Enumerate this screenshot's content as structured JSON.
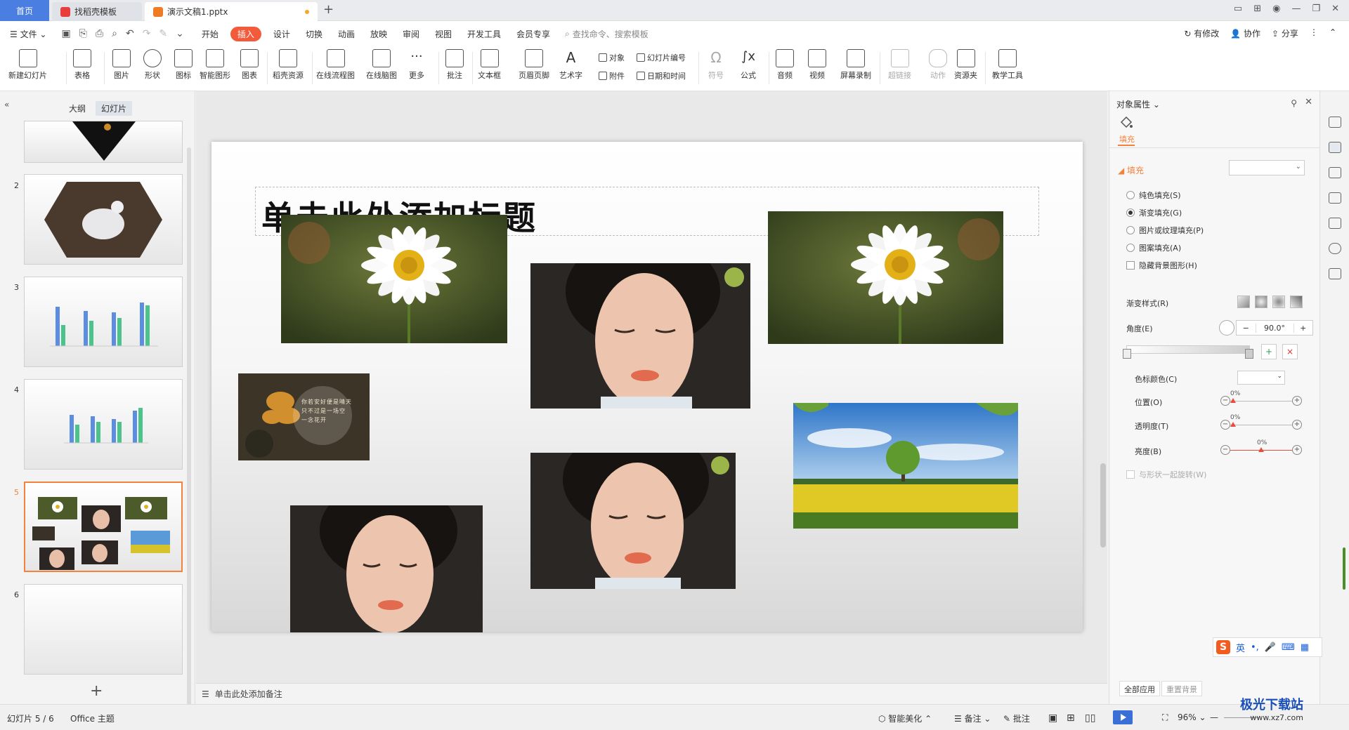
{
  "tabs": {
    "home": "首页",
    "find_template": "找稻壳模板",
    "document": "演示文稿1.pptx"
  },
  "menu": {
    "file": "文件",
    "items": [
      "开始",
      "插入",
      "设计",
      "切换",
      "动画",
      "放映",
      "审阅",
      "视图",
      "开发工具",
      "会员专享"
    ],
    "active": "插入",
    "search": "查找命令、搜索模板",
    "right": [
      "有修改",
      "协作",
      "分享"
    ]
  },
  "ribbon": {
    "new_slide": "新建幻灯片",
    "table": "表格",
    "picture": "图片",
    "shape": "形状",
    "icon": "图标",
    "smart_art": "智能图形",
    "chart": "图表",
    "docer": "稻壳资源",
    "flowchart": "在线流程图",
    "mindmap": "在线脑图",
    "more": "更多",
    "comment": "批注",
    "textbox": "文本框",
    "header_footer": "页眉页脚",
    "wordart": "艺术字",
    "object": "对象",
    "attachment": "附件",
    "slide_number": "幻灯片编号",
    "datetime": "日期和时间",
    "symbol": "符号",
    "formula": "公式",
    "audio": "音频",
    "video": "视频",
    "screen_record": "屏幕录制",
    "hyperlink": "超链接",
    "action": "动作",
    "resource": "资源夹",
    "teaching": "教学工具"
  },
  "left_panel": {
    "tab_outline": "大纲",
    "tab_slides": "幻灯片",
    "thumb_numbers": [
      "2",
      "3",
      "4",
      "5",
      "6"
    ]
  },
  "slide": {
    "title_placeholder": "单击此处添加标题",
    "autumn_text": [
      "你若安好便是晴天",
      "只不过是一场空",
      "一念花开"
    ]
  },
  "notes": {
    "placeholder": "单击此处添加备注"
  },
  "right_panel": {
    "title": "对象属性",
    "tab_fill": "填充",
    "section_fill": "填充",
    "fill_options": [
      "纯色填充(S)",
      "渐变填充(G)",
      "图片或纹理填充(P)",
      "图案填充(A)"
    ],
    "selected_fill": "渐变填充(G)",
    "hide_bg": "隐藏背景图形(H)",
    "gradient_style": "渐变样式(R)",
    "angle_label": "角度(E)",
    "angle_value": "90.0°",
    "stop_color": "色标颜色(C)",
    "position_label": "位置(O)",
    "position_value": "0%",
    "transparency_label": "透明度(T)",
    "transparency_value": "0%",
    "brightness_label": "亮度(B)",
    "brightness_value": "0%",
    "rotate_with_shape": "与形状一起旋转(W)",
    "apply_all": "全部应用",
    "reset_bg": "重置背景"
  },
  "ime": {
    "lang": "英"
  },
  "status": {
    "slide_counter": "幻灯片 5 / 6",
    "theme": "Office 主题",
    "beautify": "智能美化",
    "notes": "备注",
    "comments": "批注",
    "zoom": "96%"
  },
  "watermark": {
    "site": "极光下载站",
    "url": "www.xz7.com"
  },
  "colors": {
    "accent": "#f35a3a",
    "selected_border": "#f4823b",
    "home_tab": "#4a7ee0"
  }
}
